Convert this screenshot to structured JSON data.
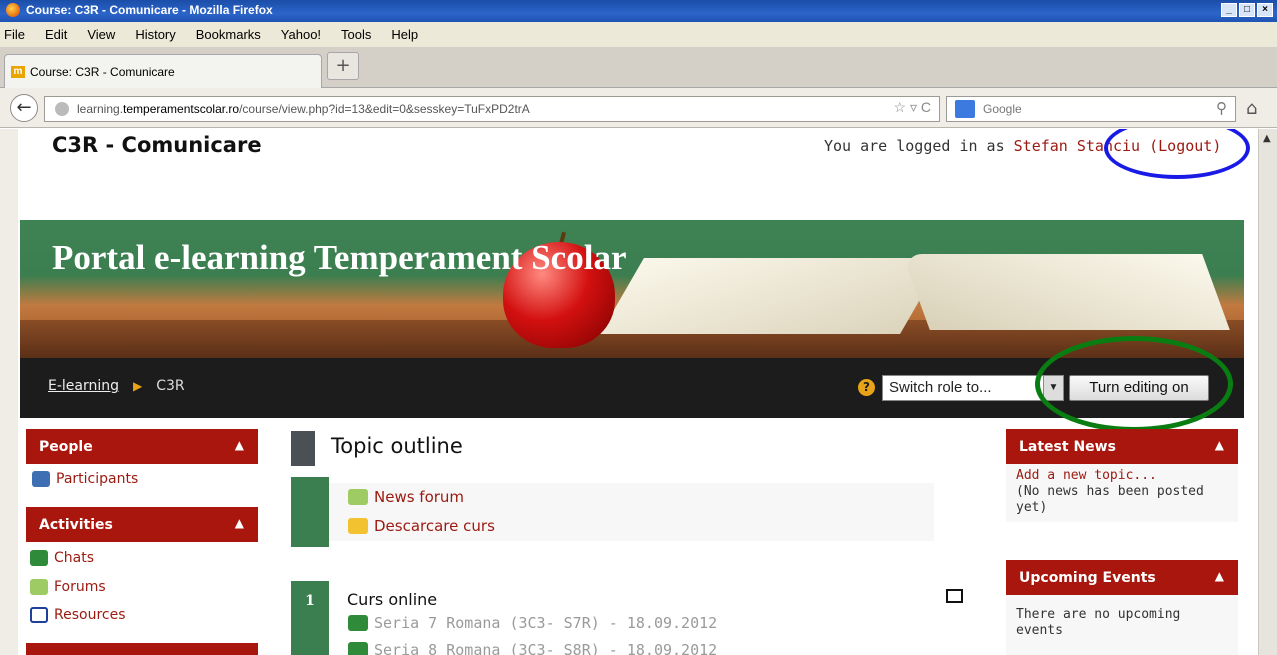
{
  "window": {
    "title": "Course: C3R - Comunicare - Mozilla Firefox"
  },
  "menubar": {
    "items": [
      "File",
      "Edit",
      "View",
      "History",
      "Bookmarks",
      "Yahoo!",
      "Tools",
      "Help"
    ]
  },
  "tabs": {
    "active": "Course: C3R - Comunicare",
    "new_tab": "+"
  },
  "navbar": {
    "url_prefix": "learning.",
    "url_domain": "temperamentscolar.ro",
    "url_path": "/course/view.php?id=13&edit=0&sesskey=TuFxPD2trA",
    "search_placeholder": "Google"
  },
  "header": {
    "site_title": "C3R - Comunicare",
    "logged_in_prefix": "You are logged in as ",
    "user_name": "Stefan Stanciu",
    "logout": "(Logout)"
  },
  "banner": {
    "title": "Portal e-learning Temperament Scolar"
  },
  "breadcrumb": {
    "home": "E-learning",
    "current": "C3R"
  },
  "controls": {
    "role_select": "Switch role to...",
    "edit_button": "Turn editing on"
  },
  "left_blocks": {
    "people_title": "People",
    "participants": "Participants",
    "activities_title": "Activities",
    "chats": "Chats",
    "forums": "Forums",
    "resources": "Resources"
  },
  "main": {
    "topic_title": "Topic outline",
    "section0": {
      "news_forum": "News forum",
      "descarcare": "Descarcare curs"
    },
    "section1": {
      "number": "1",
      "title": "Curs online",
      "item1": "Seria 7 Romana (3C3- S7R) - 18.09.2012",
      "item2": "Seria 8 Romana (3C3- S8R) - 18.09.2012"
    }
  },
  "right_blocks": {
    "news_title": "Latest News",
    "add_topic": "Add a new topic...",
    "no_news": "(No news has been posted yet)",
    "events_title": "Upcoming Events",
    "no_events": "There are no upcoming events"
  },
  "colors": {
    "block_header": "#a8160d",
    "section_green": "#3b7e4f",
    "link_red": "#9b1a10",
    "annotation_blue": "#1a1ae6",
    "annotation_green": "#0a7d12"
  }
}
